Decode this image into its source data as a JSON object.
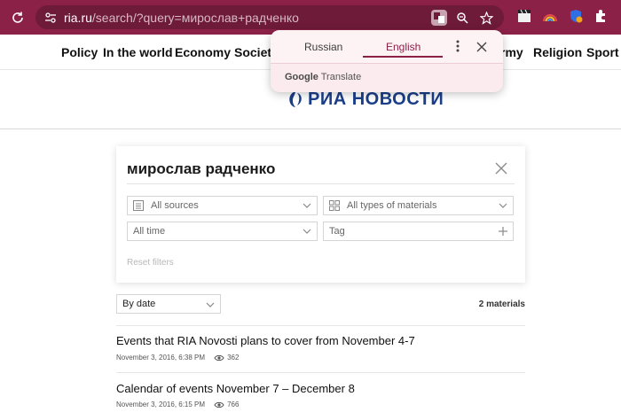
{
  "browser": {
    "url_host": "ria.ru",
    "url_path": "/search/?query=мирослав+радченко",
    "colors": {
      "toolbar": "#8c2148",
      "omnibox": "#6e1a39"
    },
    "icons": [
      "reload-icon",
      "site-info-icon",
      "translate-icon",
      "zoom-icon",
      "star-icon",
      "extension-icon"
    ]
  },
  "nav": {
    "items": [
      "Policy",
      "In the world",
      "Economy",
      "Society",
      "rmy",
      "Religion",
      "Sport"
    ]
  },
  "logo": {
    "text": "РИА НОВОСТИ",
    "color": "#1b3e8a"
  },
  "search": {
    "query": "мирослав радченко",
    "sources": "All sources",
    "types": "All types of materials",
    "time": "All time",
    "tag": "Tag",
    "reset": "Reset filters"
  },
  "results": {
    "sort": "By date",
    "count": "2 materials",
    "items": [
      {
        "title": "Events that RIA Novosti plans to cover from November 4-7",
        "date": "November 3, 2016, 6:38 PM",
        "views": "362"
      },
      {
        "title": "Calendar of events November 7 – December 8",
        "date": "November 3, 2016, 6:15 PM",
        "views": "766"
      }
    ]
  },
  "translate_popup": {
    "tab_source": "Russian",
    "tab_target": "English",
    "brand_google": "Google",
    "brand_translate": "Translate"
  }
}
